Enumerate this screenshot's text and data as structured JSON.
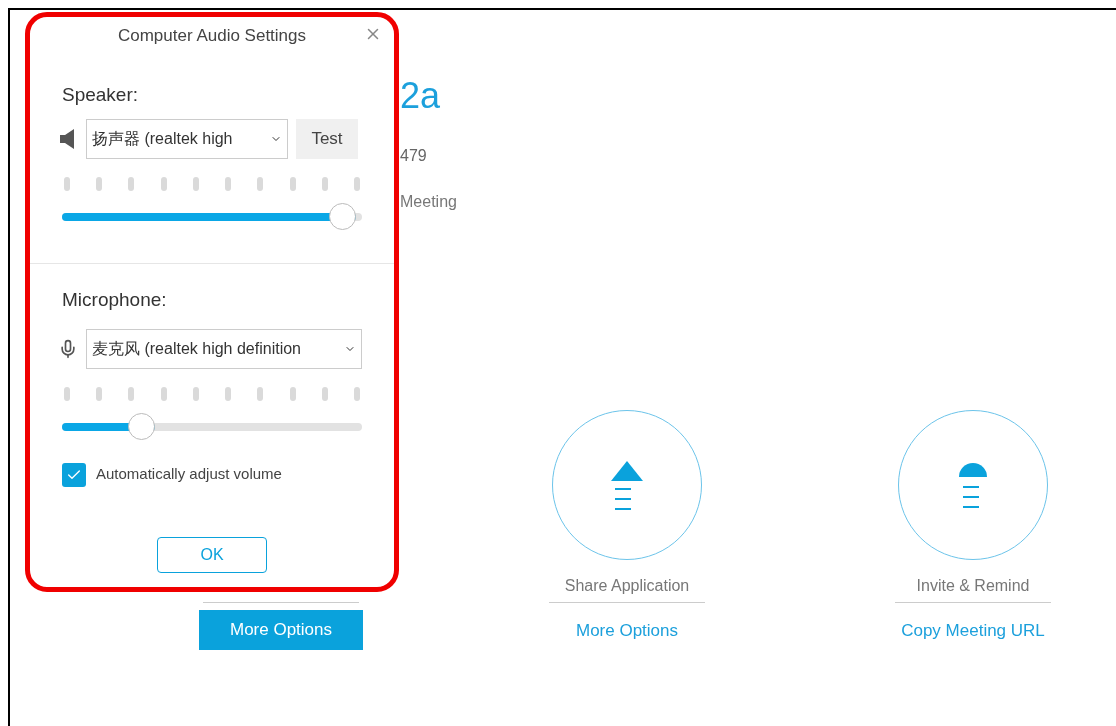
{
  "background": {
    "title_fragment": "2a",
    "number_fragment": "479",
    "end_fragment": "Meeting"
  },
  "actions": [
    {
      "kind": "audio",
      "link": "More Options",
      "selected": true
    },
    {
      "kind": "share",
      "label": "Share Application",
      "link": "More Options",
      "selected": false
    },
    {
      "kind": "invite",
      "label": "Invite & Remind",
      "link": "Copy Meeting URL",
      "selected": false
    }
  ],
  "dialog": {
    "title": "Computer Audio Settings",
    "speaker": {
      "label": "Speaker:",
      "device": "扬声器 (realtek high",
      "button": "Test",
      "level": 0.98
    },
    "microphone": {
      "label": "Microphone:",
      "device": "麦克风 (realtek high definition",
      "level": 0.31
    },
    "auto_adjust": {
      "label": "Automatically adjust volume",
      "checked": true
    },
    "ok_button": "OK"
  }
}
